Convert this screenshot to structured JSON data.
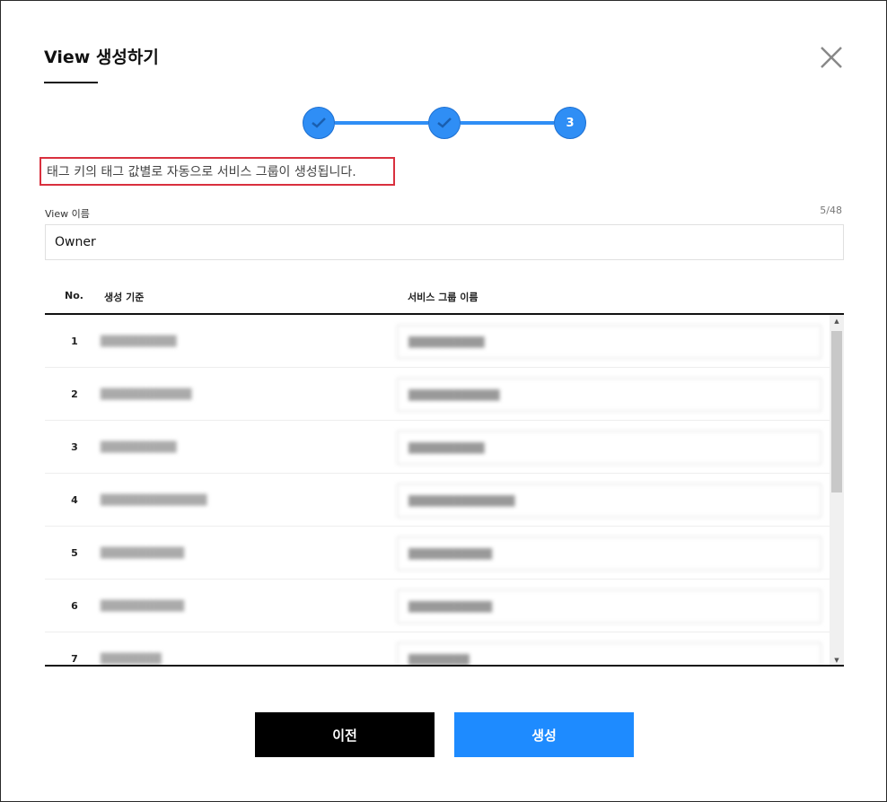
{
  "dialog": {
    "title": "View 생성하기",
    "steps": [
      {
        "state": "done",
        "label": ""
      },
      {
        "state": "done",
        "label": ""
      },
      {
        "state": "current",
        "label": "3"
      }
    ],
    "notice": "태그 키의 태그 값별로 자동으로 서비스 그룹이 생성됩니다.",
    "view_name": {
      "label": "View 이름",
      "count": "5/48",
      "value": "Owner"
    },
    "table": {
      "headers": {
        "no": "No.",
        "criteria": "생성 기준",
        "group_name": "서비스 그룹 이름"
      },
      "rows": [
        {
          "no": "1",
          "criteria": "██████████",
          "group_name": "██████████"
        },
        {
          "no": "2",
          "criteria": "████████████",
          "group_name": "████████████"
        },
        {
          "no": "3",
          "criteria": "██████████",
          "group_name": "██████████"
        },
        {
          "no": "4",
          "criteria": "██████████████",
          "group_name": "██████████████"
        },
        {
          "no": "5",
          "criteria": "███████████",
          "group_name": "███████████"
        },
        {
          "no": "6",
          "criteria": "███████████",
          "group_name": "███████████"
        },
        {
          "no": "7",
          "criteria": "████████",
          "group_name": "████████"
        }
      ]
    },
    "buttons": {
      "prev": "이전",
      "create": "생성"
    },
    "colors": {
      "accent": "#1e8bff",
      "step": "#2f8ef5",
      "notice_border": "#d9303e"
    }
  }
}
